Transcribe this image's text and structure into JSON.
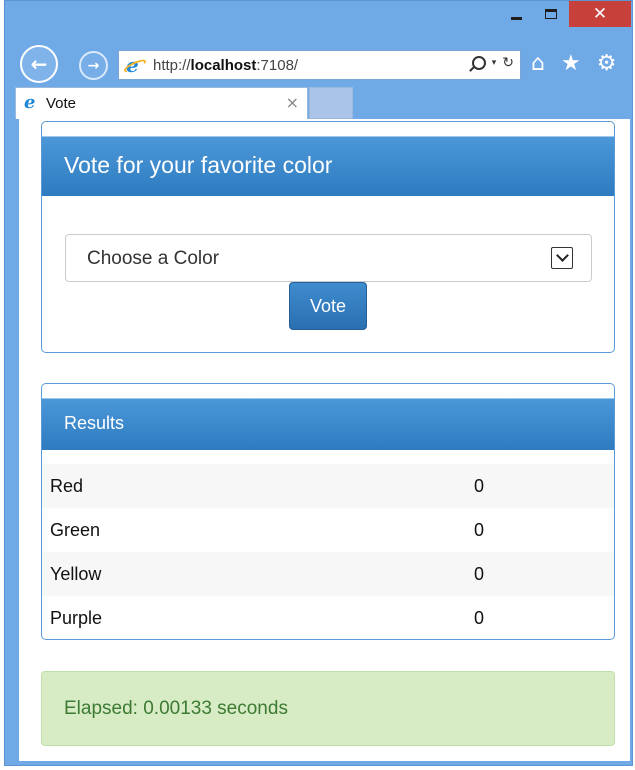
{
  "window": {
    "controls": {
      "minimize": "–",
      "maximize": "□",
      "close": "✕"
    }
  },
  "nav": {
    "back_icon": "back-arrow-icon",
    "forward_icon": "forward-arrow-icon",
    "url_prefix": "http://",
    "url_host": "localhost",
    "url_suffix": ":7108/",
    "search_glyph": "search-icon",
    "dropdown_glyph": "▾",
    "refresh_glyph": "↻",
    "home_glyph": "⌂",
    "favorites_glyph": "★",
    "settings_glyph": "⚙"
  },
  "tab": {
    "title": "Vote",
    "close": "×"
  },
  "vote_panel": {
    "heading": "Vote for your favorite color",
    "select_value": "Choose a Color",
    "button_label": "Vote"
  },
  "results_panel": {
    "heading": "Results",
    "rows": [
      {
        "color": "Red",
        "count": "0"
      },
      {
        "color": "Green",
        "count": "0"
      },
      {
        "color": "Yellow",
        "count": "0"
      },
      {
        "color": "Purple",
        "count": "0"
      }
    ]
  },
  "status": {
    "elapsed_text": "Elapsed: 0.00133 seconds"
  },
  "colors": {
    "chrome": "#6fa9e6",
    "panel_header": "#3a88cc",
    "close_button": "#c7403a",
    "success_bg": "#d7ecc5",
    "success_text": "#3d7a33"
  }
}
